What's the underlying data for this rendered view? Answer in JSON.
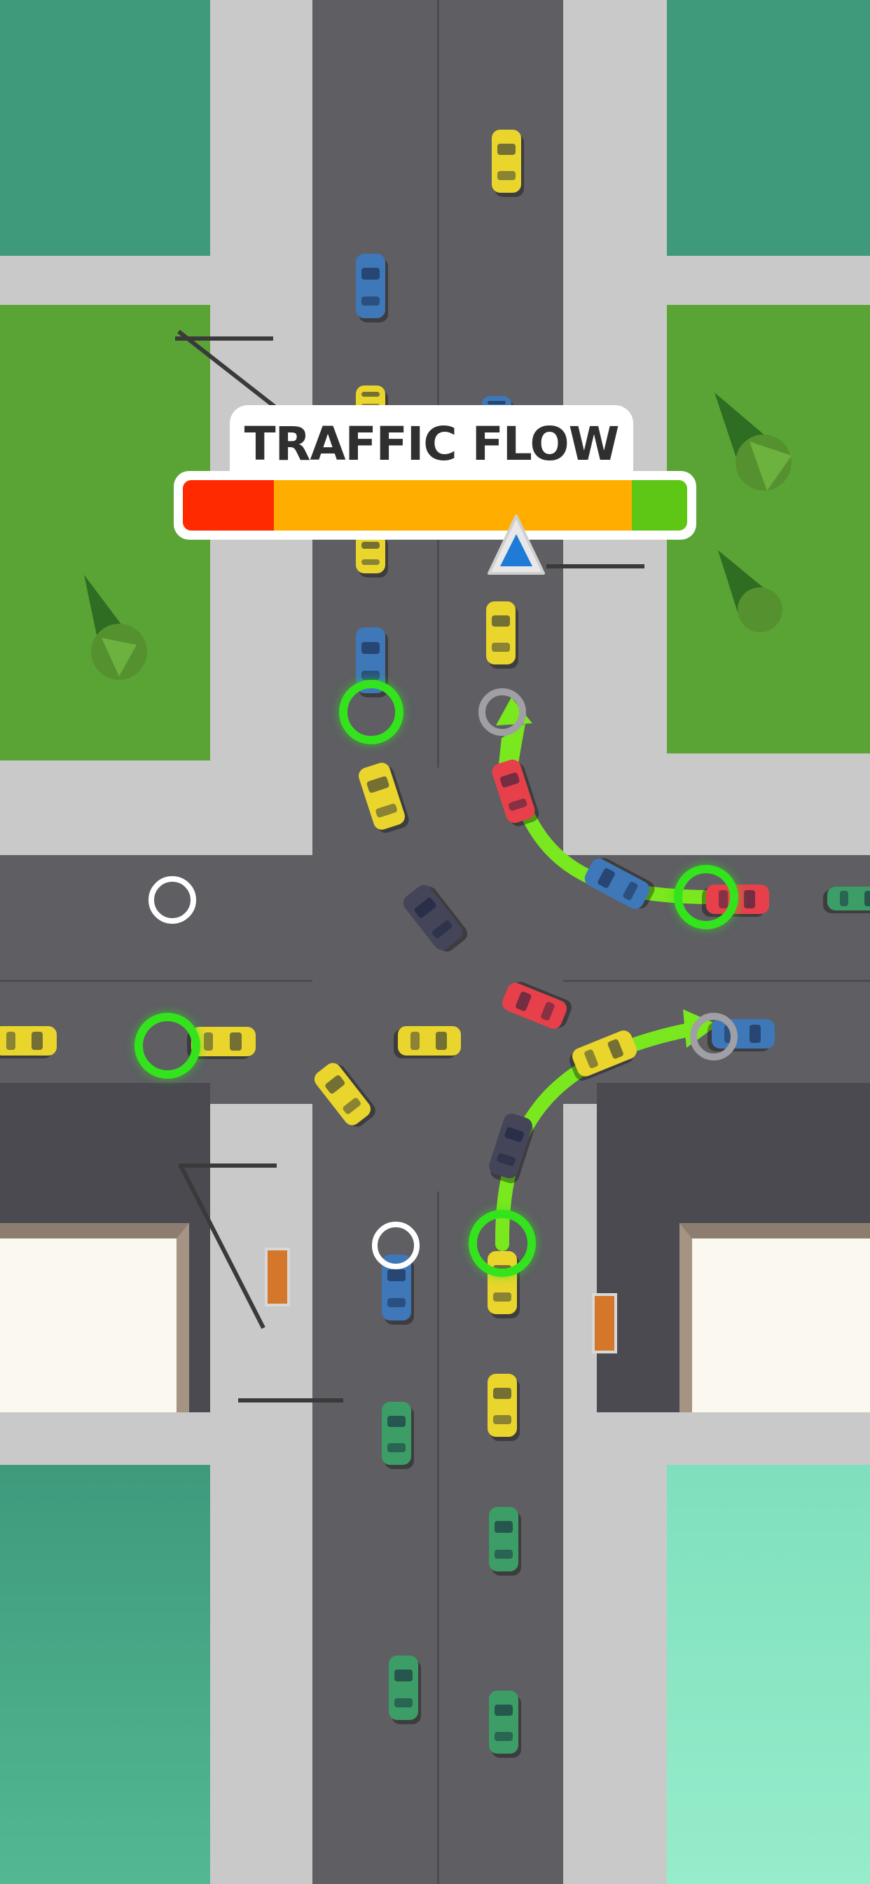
{
  "hud": {
    "title": "TRAFFIC FLOW",
    "segments": [
      {
        "name": "red",
        "color": "#ff2a00",
        "fraction": 0.18
      },
      {
        "name": "orange",
        "color": "#ffae00",
        "fraction": 0.71
      },
      {
        "name": "green",
        "color": "#5ec614",
        "fraction": 0.11
      }
    ],
    "indicator_level": 0.68,
    "indicator_color": "#1e7bd8"
  },
  "colors": {
    "grass": "#5aa436",
    "water_dark": "#3f9a7c",
    "water_light": "#92e9c7",
    "road": "#5e5e63",
    "sidewalk": "#c9c9c9",
    "path_green": "#7ae81e",
    "ring_green": "#33e41d"
  },
  "icons": {
    "indicator": "triangle-marker-icon",
    "route_arrow": "curved-arrow-icon",
    "stop_point": "ring-icon"
  }
}
